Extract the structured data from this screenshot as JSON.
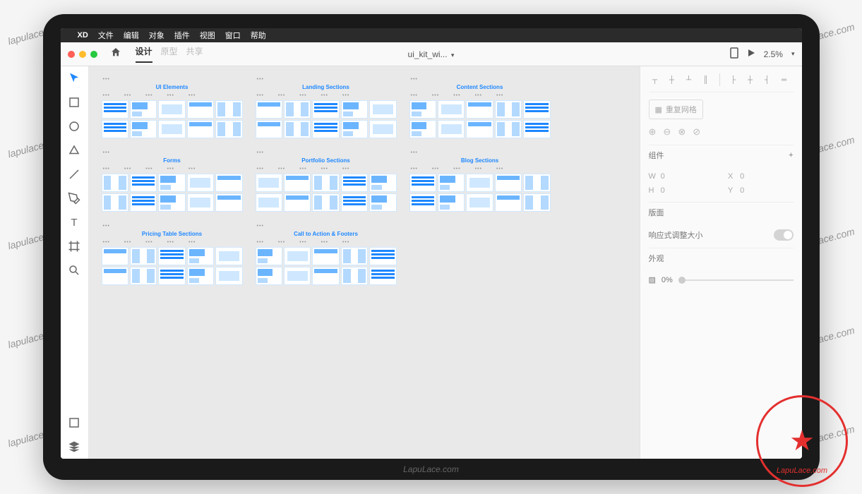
{
  "menubar": {
    "app": "XD",
    "items": [
      "文件",
      "编辑",
      "对象",
      "插件",
      "视图",
      "窗口",
      "帮助"
    ]
  },
  "toolbar": {
    "tabs": {
      "design": "设计",
      "prototype": "原型",
      "share": "共享"
    },
    "title": "ui_kit_wi...",
    "zoom": "2.5%"
  },
  "canvas": {
    "sections": [
      {
        "title": "UI Elements"
      },
      {
        "title": "Landing Sections"
      },
      {
        "title": "Content Sections"
      },
      {
        "title": "Forms"
      },
      {
        "title": "Portfolio Sections"
      },
      {
        "title": "Blog Sections"
      },
      {
        "title": "Pricing Table Sections"
      },
      {
        "title": "Call to Action & Footers"
      }
    ]
  },
  "panel": {
    "repeat_grid": "重复网格",
    "component": "组件",
    "dims": {
      "w_label": "W",
      "w": "0",
      "x_label": "X",
      "x": "0",
      "h_label": "H",
      "h": "0",
      "y_label": "Y",
      "y": "0"
    },
    "layout": "版面",
    "responsive": "响应式调整大小",
    "appearance": "外观",
    "opacity": "0%"
  },
  "watermark": "lapulace.com",
  "footer_mark": "LapuLace.com",
  "stamp_text": "LapuLace.com"
}
